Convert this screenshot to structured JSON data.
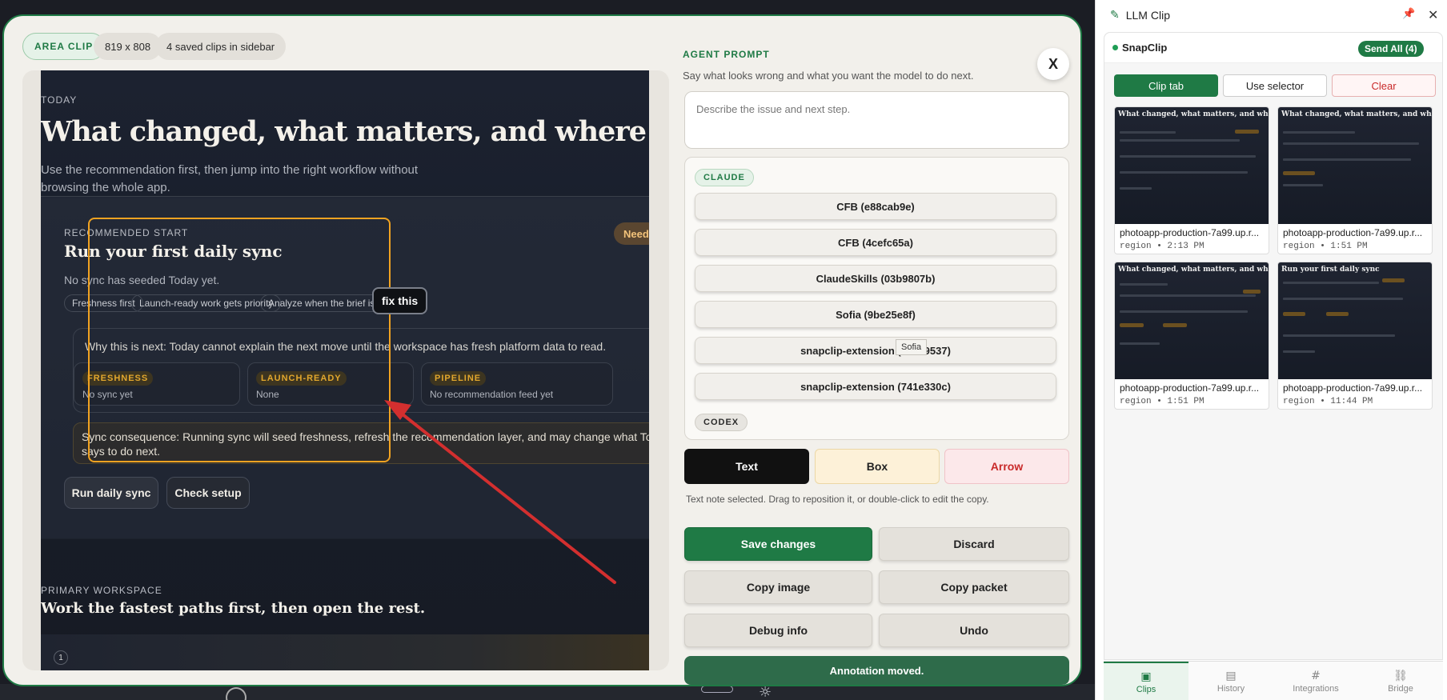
{
  "modal": {
    "chips": {
      "area": "AREA CLIP",
      "size": "819 x 808",
      "saved": "4 saved clips in sidebar"
    },
    "close_label": "X"
  },
  "preview": {
    "today": "TODAY",
    "headline": "What changed, what matters, and where to",
    "sub": "Use the recommendation first, then jump into the right workflow without browsing the whole app.",
    "rec_label": "RECOMMENDED START",
    "rec_title": "Run your first daily sync",
    "rec_none": "No sync has seeded Today yet.",
    "needs": "Need",
    "tags": [
      "Freshness first",
      "Launch-ready work gets priority",
      "Analyze when the brief is strong"
    ],
    "why": "Why this is next: Today cannot explain the next move until the workspace has fresh platform data to read.",
    "minis": [
      {
        "label": "FRESHNESS",
        "value": "No sync yet"
      },
      {
        "label": "LAUNCH-READY",
        "value": "None"
      },
      {
        "label": "PIPELINE",
        "value": "No recommendation feed yet"
      }
    ],
    "consequence": "Sync consequence: Running sync will seed freshness, refresh the recommendation layer, and may change what Today says to do next.",
    "btn_run": "Run daily sync",
    "btn_check": "Check setup",
    "primary_label": "PRIMARY WORKSPACE",
    "primary_title": "Work the fastest paths first, then open the rest.",
    "step": "1",
    "annotation": "fix this"
  },
  "prompt": {
    "title": "AGENT PROMPT",
    "sub": "Say what looks wrong and what you want the model to do next.",
    "placeholder": "Describe the issue and next step."
  },
  "sessions": {
    "claude_label": "CLAUDE",
    "codex_label": "CODEX",
    "items": [
      "CFB (e88cab9e)",
      "CFB (4cefc65a)",
      "ClaudeSkills (03b9807b)",
      "Sofia (9be25e8f)",
      "snapclip-extension (32a49537)",
      "snapclip-extension (741e330c)"
    ],
    "tooltip": "Sofia"
  },
  "tools": {
    "text": "Text",
    "box": "Box",
    "arrow": "Arrow",
    "hint": "Text note selected. Drag to reposition it, or double-click to edit the copy."
  },
  "actions": {
    "save": "Save changes",
    "discard": "Discard",
    "copy_image": "Copy image",
    "copy_packet": "Copy packet",
    "debug": "Debug info",
    "undo": "Undo",
    "status": "Annotation moved."
  },
  "sidebar": {
    "title": "LLM Clip",
    "project": "SnapClip",
    "send_all": "Send All (4)",
    "btn_clip": "Clip tab",
    "btn_selector": "Use selector",
    "btn_clear": "Clear",
    "clips": [
      {
        "name": "photoapp-production-7a99.up.r...",
        "meta": "region • 2:13 PM",
        "preview_title": "What changed, what matters, and where to go"
      },
      {
        "name": "photoapp-production-7a99.up.r...",
        "meta": "region • 1:51 PM",
        "preview_title": "What changed, what matters, and where to go"
      },
      {
        "name": "photoapp-production-7a99.up.r...",
        "meta": "region • 1:51 PM",
        "preview_title": "What changed, what matters, and where to go n"
      },
      {
        "name": "photoapp-production-7a99.up.r...",
        "meta": "region • 11:44 PM",
        "preview_title": "Run your first daily sync"
      }
    ],
    "tabs": [
      {
        "label": "Clips",
        "icon": "image-icon"
      },
      {
        "label": "History",
        "icon": "document-icon"
      },
      {
        "label": "Integrations",
        "icon": "hash-icon"
      },
      {
        "label": "Bridge",
        "icon": "link-icon"
      }
    ]
  },
  "colors": {
    "brand_green": "#1f7a45",
    "box_orange": "#f1a321",
    "arrow_red": "#d32f2f"
  }
}
